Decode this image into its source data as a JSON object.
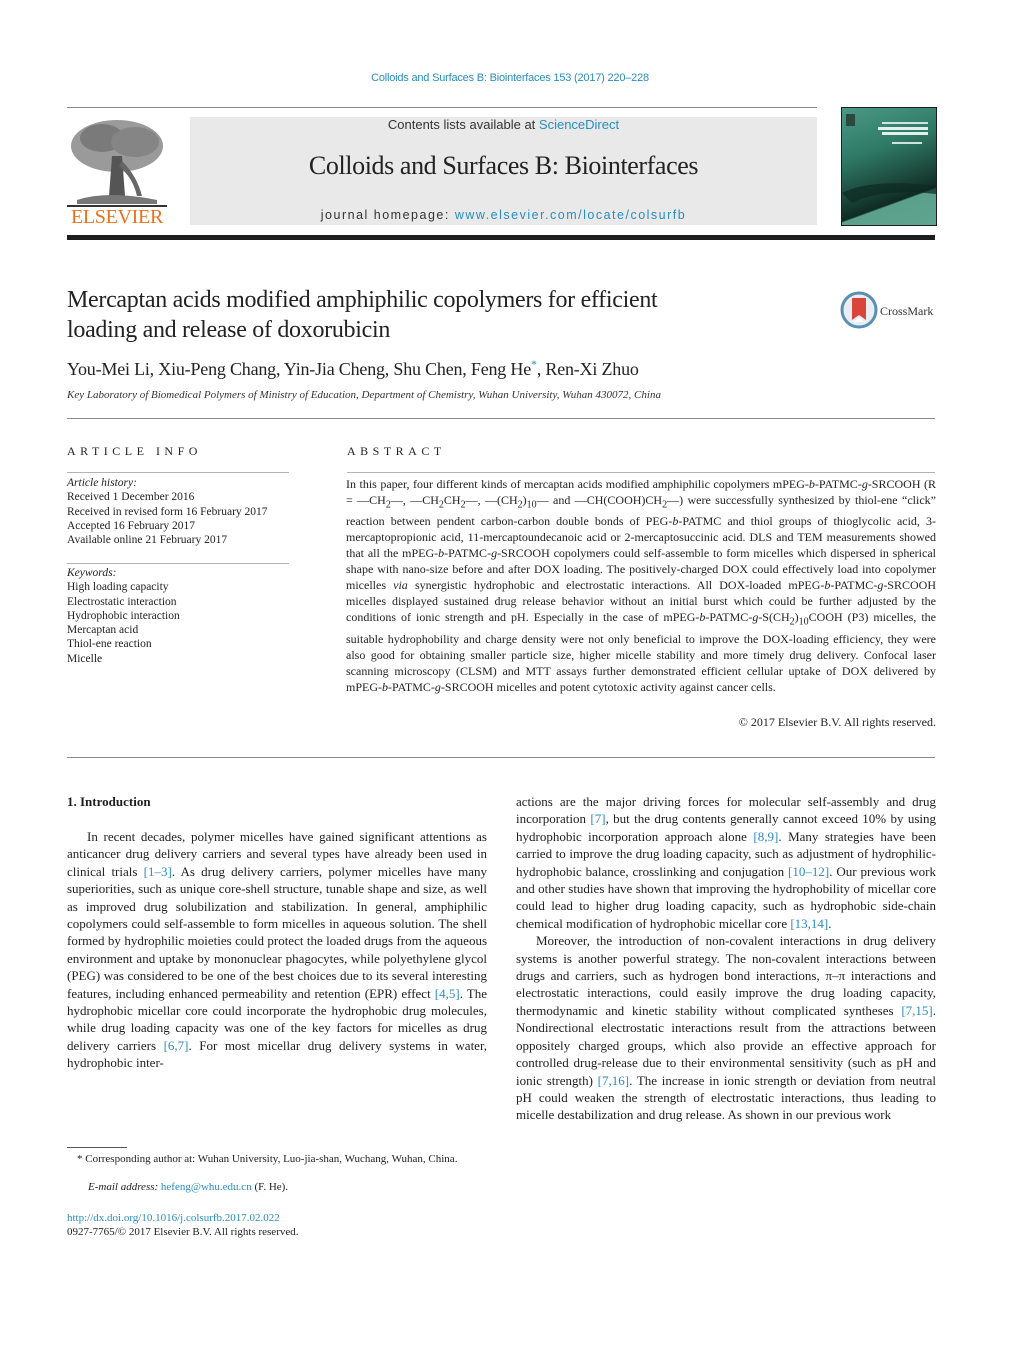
{
  "running_head": "Colloids and Surfaces B: Biointerfaces 153 (2017) 220–228",
  "masthead": {
    "publisher_logo_text": "ELSEVIER",
    "contents_prefix": "Contents lists available at ",
    "contents_link": "ScienceDirect",
    "journal_title": "Colloids and Surfaces B: Biointerfaces",
    "homepage_prefix": "journal homepage: ",
    "homepage_link": "www.elsevier.com/locate/colsurfb",
    "cover_icon": "journal-cover-thumbnail"
  },
  "article": {
    "title_line1": "Mercaptan acids modified amphiphilic copolymers for efficient",
    "title_line2": "loading and release of doxorubicin",
    "crossmark_label": "CrossMark",
    "authors_before_star": "You-Mei Li, Xiu-Peng Chang, Yin-Jia Cheng, Shu Chen, Feng He",
    "author_star": "*",
    "authors_after_star": ", Ren-Xi Zhuo",
    "affiliation": "Key Laboratory of Biomedical Polymers of Ministry of Education, Department of Chemistry, Wuhan University, Wuhan 430072, China"
  },
  "article_info": {
    "heading": "ARTICLE INFO",
    "history_label": "Article history:",
    "history": [
      "Received 1 December 2016",
      "Received in revised form 16 February 2017",
      "Accepted 16 February 2017",
      "Available online 21 February 2017"
    ],
    "keywords_label": "Keywords:",
    "keywords": [
      "High loading capacity",
      "Electrostatic interaction",
      "Hydrophobic interaction",
      "Mercaptan acid",
      "Thiol-ene reaction",
      "Micelle"
    ]
  },
  "abstract": {
    "heading": "ABSTRACT",
    "segments": {
      "s1": "In this paper, four different kinds of mercaptan acids modified amphiphilic copolymers mPEG-",
      "s2_i": "b",
      "s3": "-PATMC-",
      "s4_i": "g",
      "s5": "-SRCOOH (R = —CH",
      "s6_sub": "2",
      "s7": "—, —CH",
      "s8_sub": "2",
      "s9": "CH",
      "s10_sub": "2",
      "s11": "—, —(CH",
      "s12_sub": "2",
      "s13": ")",
      "s14_sub": "10",
      "s15": "— and —CH(COOH)CH",
      "s16_sub": "2",
      "s17": "—) were successfully synthesized by thiol-ene “click” reaction between pendent carbon-carbon double bonds of PEG-",
      "s18_i": "b",
      "s19": "-PATMC and thiol groups of thioglycolic acid, 3-mercaptopropionic acid, 11-mercaptoundecanoic acid or 2-mercaptosuccinic acid. DLS and TEM measurements showed that all the mPEG-",
      "s20_i": "b",
      "s21": "-PATMC-",
      "s22_i": "g",
      "s23": "-SRCOOH copolymers could self-assemble to form micelles which dispersed in spherical shape with nano-size before and after DOX loading. The positively-charged DOX could effectively load into copolymer micelles ",
      "s24_i": "via",
      "s25": " synergistic hydrophobic and electrostatic interactions. All DOX-loaded mPEG-",
      "s26_i": "b",
      "s27": "-PATMC-",
      "s28_i": "g",
      "s29": "-SRCOOH micelles displayed sustained drug release behavior without an initial burst which could be further adjusted by the conditions of ionic strength and pH. Especially in the case of mPEG-",
      "s30_i": "b",
      "s31": "-PATMC-",
      "s32_i": "g",
      "s33": "-S(CH",
      "s34_sub": "2",
      "s35": ")",
      "s36_sub": "10",
      "s37": "COOH (P3) micelles, the suitable hydrophobility and charge density were not only beneficial to improve the DOX-loading efficiency, they were also good for obtaining smaller particle size, higher micelle stability and more timely drug delivery. Confocal laser scanning microscopy (CLSM) and MTT assays further demonstrated efficient cellular uptake of DOX delivered by mPEG-",
      "s38_i": "b",
      "s39": "-PATMC-",
      "s40_i": "g",
      "s41": "-SRCOOH micelles and potent cytotoxic activity against cancer cells."
    },
    "copyright": "© 2017 Elsevier B.V. All rights reserved."
  },
  "introduction": {
    "heading": "1.  Introduction",
    "left_column": {
      "p1_a": "In recent decades, polymer micelles have gained significant attentions as anticancer drug delivery carriers and several types have already been used in clinical trials ",
      "p1_ref1": "[1–3]",
      "p1_b": ". As drug delivery carriers, polymer micelles have many superiorities, such as unique core-shell structure, tunable shape and size, as well as improved drug solubilization and stabilization. In general, amphiphilic copolymers could self-assemble to form micelles in aqueous solution. The shell formed by hydrophilic moieties could protect the loaded drugs from the aqueous environment and uptake by mononuclear phagocytes, while polyethylene glycol (PEG) was considered to be one of the best choices due to its several interesting features, including enhanced permeability and retention (EPR) effect ",
      "p1_ref2": "[4,5]",
      "p1_c": ". The hydrophobic micellar core could incorporate the hydrophobic drug molecules, while drug loading capacity was one of the key factors for micelles as drug delivery carriers ",
      "p1_ref3": "[6,7]",
      "p1_d": ". For most micellar drug delivery systems in water, hydrophobic inter-"
    },
    "right_column": {
      "p1_a": "actions are the major driving forces for molecular self-assembly and drug incorporation ",
      "p1_ref1": "[7]",
      "p1_b": ", but the drug contents generally cannot exceed 10% by using hydrophobic incorporation approach alone ",
      "p1_ref2": "[8,9]",
      "p1_c": ". Many strategies have been carried to improve the drug loading capacity, such as adjustment of hydrophilic-hydrophobic balance, crosslinking and conjugation ",
      "p1_ref3": "[10–12]",
      "p1_d": ". Our previous work and other studies have shown that improving the hydrophobility of micellar core could lead to higher drug loading capacity, such as hydrophobic side-chain chemical modification of hydrophobic micellar core ",
      "p1_ref4": "[13,14]",
      "p1_e": ".",
      "p2_a": "Moreover, the introduction of non-covalent interactions in drug delivery systems is another powerful strategy. The non-covalent interactions between drugs and carriers, such as hydrogen bond interactions, π–π interactions and electrostatic interactions, could easily improve the drug loading capacity, thermodynamic and kinetic stability without complicated syntheses ",
      "p2_ref1": "[7,15]",
      "p2_b": ". Nondirectional electrostatic interactions result from the attractions between oppositely charged groups, which also provide an effective approach for controlled drug-release due to their environmental sensitivity (such as pH and ionic strength) ",
      "p2_ref2": "[7,16]",
      "p2_c": ". The increase in ionic strength or deviation from neutral pH could weaken the strength of electrostatic interactions, thus leading to micelle destabilization and drug release. As shown in our previous work"
    }
  },
  "footnotes": {
    "corresponding": "* Corresponding author at: Wuhan University, Luo-jia-shan, Wuchang, Wuhan, China.",
    "email_label": "E-mail address: ",
    "email": "hefeng@whu.edu.cn",
    "email_suffix": " (F. He).",
    "doi": "http://dx.doi.org/10.1016/j.colsurfb.2017.02.022",
    "issn_line": "0927-7765/© 2017 Elsevier B.V. All rights reserved."
  },
  "colors": {
    "link": "#2b8cbe",
    "elsevier_orange": "#e9711c",
    "masthead_band": "#e9e9e9",
    "rule_dark": "#1e1e1e"
  }
}
